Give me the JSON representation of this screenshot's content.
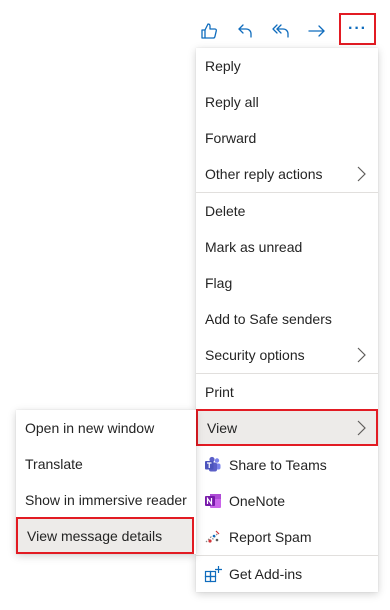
{
  "toolbar": {
    "icons": [
      "like-icon",
      "reply-icon",
      "reply-all-icon",
      "forward-icon",
      "more-options-icon"
    ],
    "more_label": "···"
  },
  "menu": {
    "reply": "Reply",
    "reply_all": "Reply all",
    "forward": "Forward",
    "other_reply_actions": "Other reply actions",
    "delete": "Delete",
    "mark_unread": "Mark as unread",
    "flag": "Flag",
    "add_safe_senders": "Add to Safe senders",
    "security_options": "Security options",
    "print": "Print",
    "view": "View",
    "share_teams": "Share to Teams",
    "onenote": "OneNote",
    "report_spam": "Report Spam",
    "get_addins": "Get Add-ins"
  },
  "submenu": {
    "open_new_window": "Open in new window",
    "translate": "Translate",
    "immersive_reader": "Show in immersive reader",
    "view_message_details": "View message details"
  },
  "colors": {
    "accent": "#0f6cbd",
    "highlight_border": "#e21b23",
    "teams": "#5b5fc7",
    "onenote": "#7719aa"
  }
}
